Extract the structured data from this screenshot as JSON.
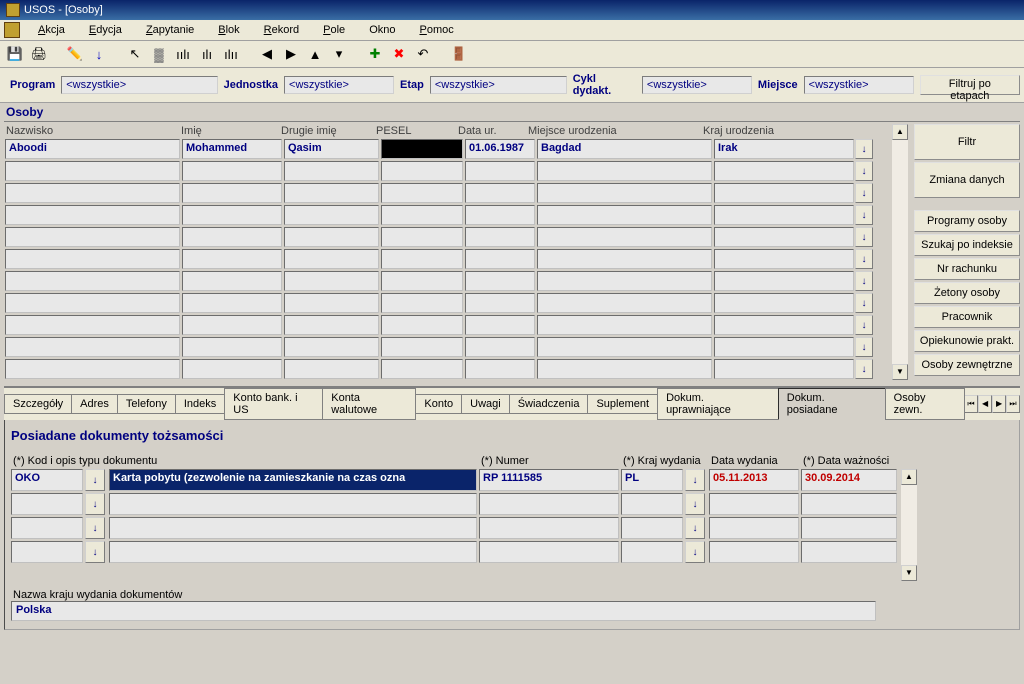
{
  "window_title": "USOS - [Osoby]",
  "menu": [
    "Akcja",
    "Edycja",
    "Zapytanie",
    "Blok",
    "Rekord",
    "Pole",
    "Okno",
    "Pomoc"
  ],
  "filters": {
    "program_lbl": "Program",
    "program_val": "<wszystkie>",
    "jednostka_lbl": "Jednostka",
    "jednostka_val": "<wszystkie>",
    "etap_lbl": "Etap",
    "etap_val": "<wszystkie>",
    "cykl_lbl": "Cykl dydakt.",
    "cykl_val": "<wszystkie>",
    "miejsce_lbl": "Miejsce",
    "miejsce_val": "<wszystkie>",
    "filter_stages": "Filtruj po etapach"
  },
  "section_title": "Osoby",
  "grid_headers": {
    "nazwisko": "Nazwisko",
    "imie": "Imię",
    "drugie": "Drugie imię",
    "pesel": "PESEL",
    "dataur": "Data ur.",
    "miejsce": "Miejsce urodzenia",
    "kraj": "Kraj urodzenia"
  },
  "grid_row": {
    "nazwisko": "Aboodi",
    "imie": "Mohammed",
    "drugie": "Qasim",
    "pesel": "",
    "dataur": "01.06.1987",
    "miejsce": "Bagdad",
    "kraj": "Irak"
  },
  "side_buttons": [
    "Filtr",
    "Zmiana danych",
    "Programy osoby",
    "Szukaj po indeksie",
    "Nr rachunku",
    "Żetony osoby",
    "Pracownik",
    "Opiekunowie prakt.",
    "Osoby zewnętrzne"
  ],
  "tabs": [
    "Szczegóły",
    "Adres",
    "Telefony",
    "Indeks",
    "Konto bank. i US",
    "Konta walutowe",
    "Konto",
    "Uwagi",
    "Świadczenia",
    "Suplement",
    "Dokum. uprawniające",
    "Dokum. posiadane",
    "Osoby zewn."
  ],
  "active_tab": 11,
  "doc_title": "Posiadane dokumenty tożsamości",
  "doc_headers": {
    "kod": "(*) Kod i opis typu dokumentu",
    "numer": "(*) Numer",
    "kraj": "(*) Kraj wydania",
    "data_wyd": "Data wydania",
    "data_waz": "(*) Data ważności"
  },
  "doc_row": {
    "kod": "OKO",
    "opis": "Karta pobytu (zezwolenie na zamieszkanie na czas ozna",
    "numer": "RP 1111585",
    "kraj": "PL",
    "data_wyd": "05.11.2013",
    "data_waz": "30.09.2014"
  },
  "country_label": "Nazwa kraju wydania dokumentów",
  "country_value": "Polska",
  "arrow_down": "↓"
}
